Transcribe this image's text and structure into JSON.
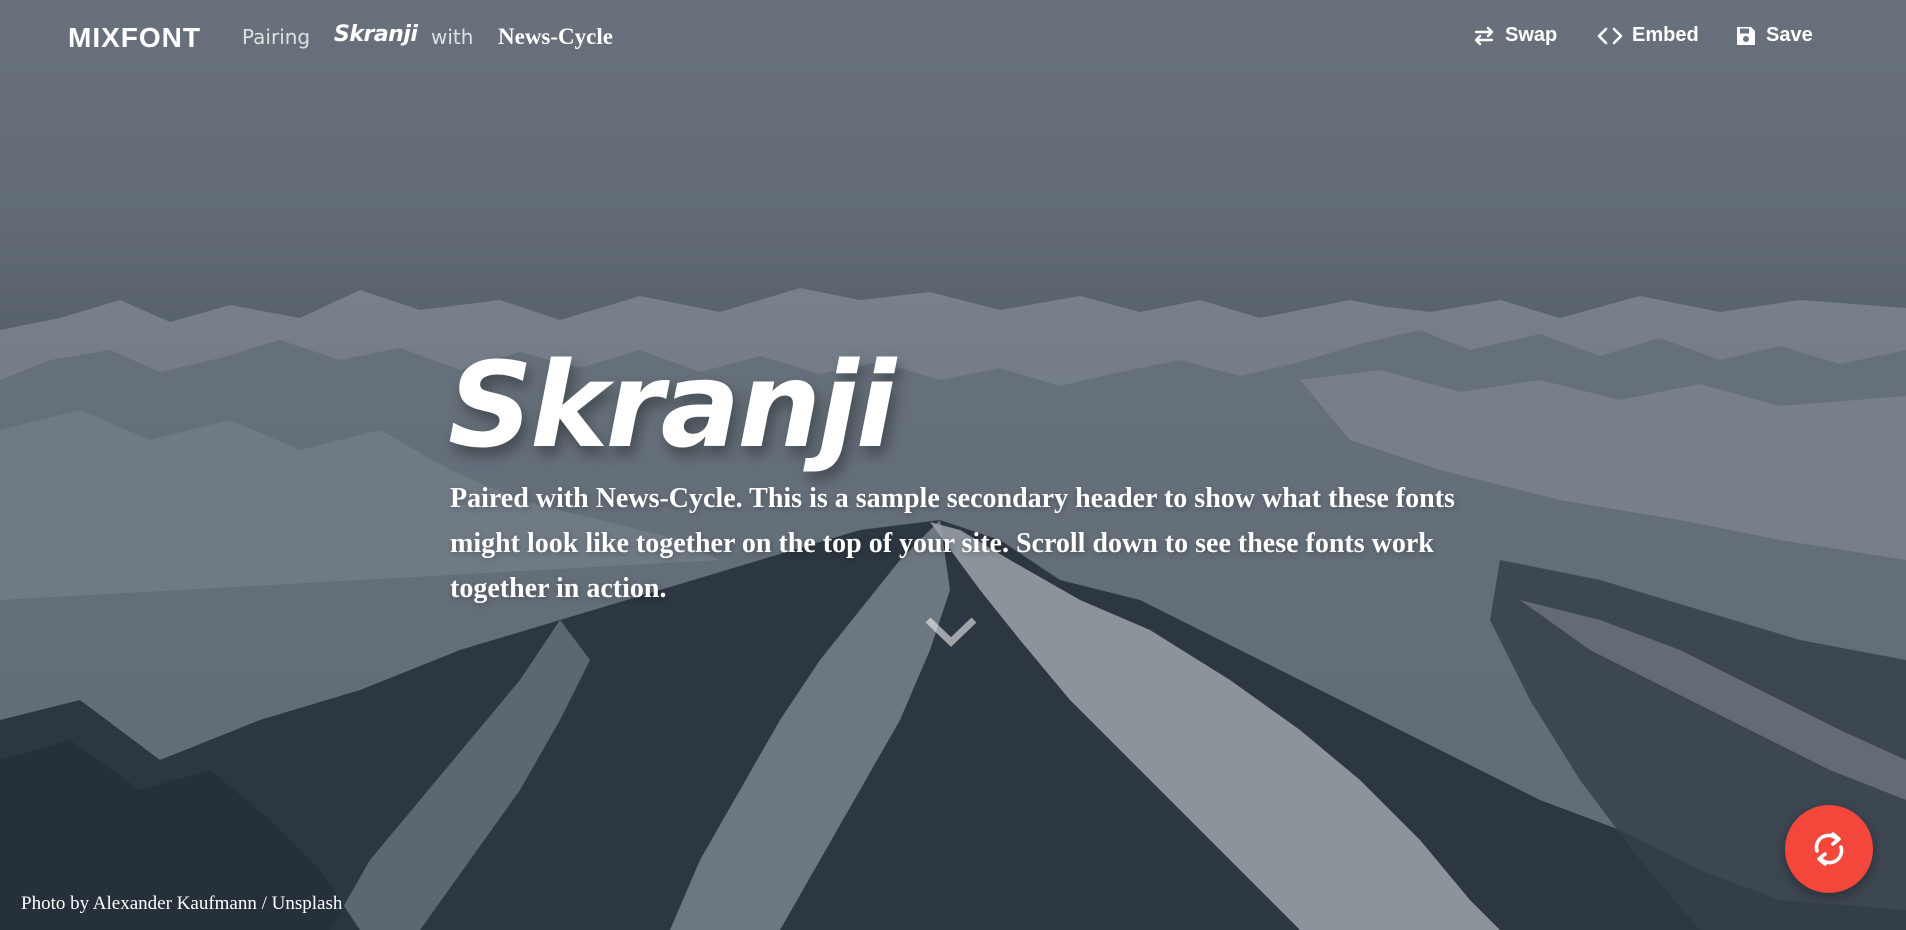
{
  "nav": {
    "logo": "MIXFONT",
    "pairing_label": "Pairing",
    "font_primary": "Skranji",
    "with_label": "with",
    "font_secondary": "News-Cycle",
    "swap_label": "Swap",
    "embed_label": "Embed",
    "save_label": "Save"
  },
  "hero": {
    "headline": "Skranji",
    "subhead": "Paired with News-Cycle. This is a sample secondary header to show what these fonts might look like together on the top of your site. Scroll down to see these fonts work together in action."
  },
  "credit": "Photo by Alexander Kaufmann / Unsplash",
  "icons": {
    "swap": "swap-arrows-icon",
    "embed": "code-brackets-icon",
    "save": "floppy-disk-icon",
    "scroll": "chevron-down-icon",
    "refresh": "refresh-icon"
  },
  "colors": {
    "fab": "#f2473a",
    "text": "#ffffff"
  }
}
